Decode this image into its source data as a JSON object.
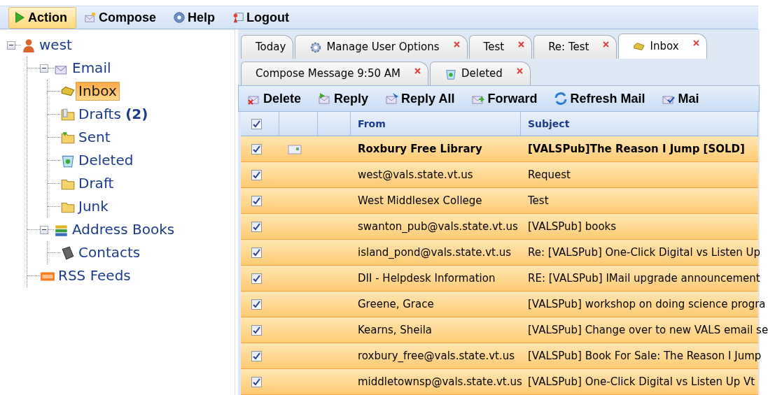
{
  "menu": [
    {
      "label": "Action",
      "kind": "play",
      "selected": true
    },
    {
      "label": "Compose",
      "kind": "compose",
      "selected": false
    },
    {
      "label": "Help",
      "kind": "help",
      "selected": false
    },
    {
      "label": "Logout",
      "kind": "logout",
      "selected": false
    }
  ],
  "tree": [
    {
      "label": "west",
      "kind": "user",
      "expanded": true,
      "selected": false,
      "children": [
        {
          "label": "Email",
          "kind": "envelope",
          "expanded": true,
          "selected": false,
          "children": [
            {
              "label": "Inbox",
              "kind": "inbox",
              "selected": true
            },
            {
              "label": "Drafts **(2)**",
              "kind": "drafts",
              "selected": false
            },
            {
              "label": "Sent",
              "kind": "sent",
              "selected": false
            },
            {
              "label": "Deleted",
              "kind": "trash",
              "selected": false
            },
            {
              "label": "Draft",
              "kind": "folder",
              "selected": false
            },
            {
              "label": "Junk",
              "kind": "folder",
              "selected": false
            }
          ]
        },
        {
          "label": "Address Books",
          "kind": "books",
          "expanded": true,
          "selected": false,
          "children": [
            {
              "label": "Contacts",
              "kind": "book",
              "selected": false
            }
          ]
        },
        {
          "label": "RSS Feeds",
          "kind": "rss",
          "selected": false
        }
      ]
    }
  ],
  "tab_rows": [
    [
      {
        "label": "Today",
        "kind": "none",
        "closable": false,
        "selected": false
      },
      {
        "label": "Manage User Options",
        "kind": "gear",
        "closable": true,
        "selected": false
      },
      {
        "label": "Test",
        "kind": "none",
        "closable": true,
        "selected": false
      },
      {
        "label": "Re: Test",
        "kind": "none",
        "closable": true,
        "selected": false
      },
      {
        "label": "Inbox",
        "kind": "inbox",
        "closable": true,
        "selected": true
      }
    ],
    [
      {
        "label": "Compose Message 9:50 AM",
        "kind": "none",
        "closable": true,
        "selected": false
      },
      {
        "label": "Deleted",
        "kind": "trash",
        "closable": true,
        "selected": false
      }
    ]
  ],
  "toolbar": [
    {
      "label": "Delete",
      "kind": "delete"
    },
    {
      "label": "Reply",
      "kind": "reply"
    },
    {
      "label": "Reply All",
      "kind": "replyall"
    },
    {
      "label": "Forward",
      "kind": "forward"
    },
    {
      "label": "Refresh Mail",
      "kind": "refresh"
    },
    {
      "label": "Mai",
      "kind": "mailcheck"
    }
  ],
  "table": {
    "all_checked": true,
    "columns": [
      "From",
      "Subject"
    ],
    "rows": [
      {
        "checked": true,
        "unread": true,
        "from": "Roxbury Free Library",
        "subject": "[VALSPub]The Reason I Jump [SOLD]"
      },
      {
        "checked": true,
        "unread": false,
        "from": "west@vals.state.vt.us",
        "subject": "Request"
      },
      {
        "checked": true,
        "unread": false,
        "from": "West Middlesex College",
        "subject": "Test"
      },
      {
        "checked": true,
        "unread": false,
        "from": "swanton_pub@vals.state.vt.us",
        "subject": "[VALSPub] books"
      },
      {
        "checked": true,
        "unread": false,
        "from": "island_pond@vals.state.vt.us",
        "subject": "Re: [VALSPub] One-Click Digital vs Listen Up"
      },
      {
        "checked": true,
        "unread": false,
        "from": "DII - Helpdesk Information",
        "subject": "RE: [VALSPub] IMail upgrade announcement"
      },
      {
        "checked": true,
        "unread": false,
        "from": "Greene, Grace",
        "subject": "[VALSPub] workshop on doing science progra"
      },
      {
        "checked": true,
        "unread": false,
        "from": "Kearns, Sheila",
        "subject": "[VALSPub] Change over to new VALS email se"
      },
      {
        "checked": true,
        "unread": false,
        "from": "roxbury_free@vals.state.vt.us",
        "subject": "[VALSPub] Book For Sale: The Reason I Jump"
      },
      {
        "checked": true,
        "unread": false,
        "from": "middletownsp@vals.state.vt.us",
        "subject": "[VALSPub] One-Click Digital vs Listen Up Vt"
      }
    ]
  }
}
